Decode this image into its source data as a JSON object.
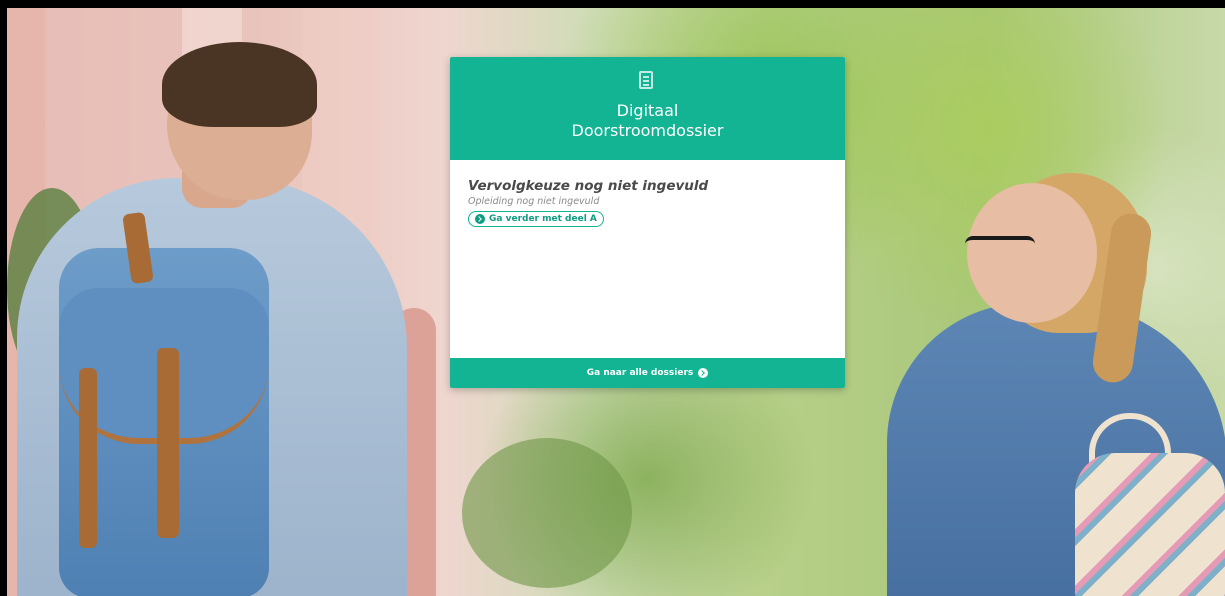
{
  "header": {
    "title": "Digitaal\nDoorstroomdossier",
    "icon": "document-icon"
  },
  "status": {
    "heading": "Vervolgkeuze nog niet ingevuld",
    "subtext": "Opleiding nog niet ingevuld",
    "action_label": "Ga verder met deel A",
    "action_icon": "circle-arrow-right-icon"
  },
  "footer": {
    "link_label": "Ga naar alle dossiers",
    "link_icon": "circle-arrow-right-icon"
  },
  "colors": {
    "brand": "#12b494",
    "card_background": "#ffffff",
    "heading_text": "#4a4a4a",
    "muted_text": "#8a8a8a"
  },
  "background": {
    "description_icon": "photo-background"
  }
}
